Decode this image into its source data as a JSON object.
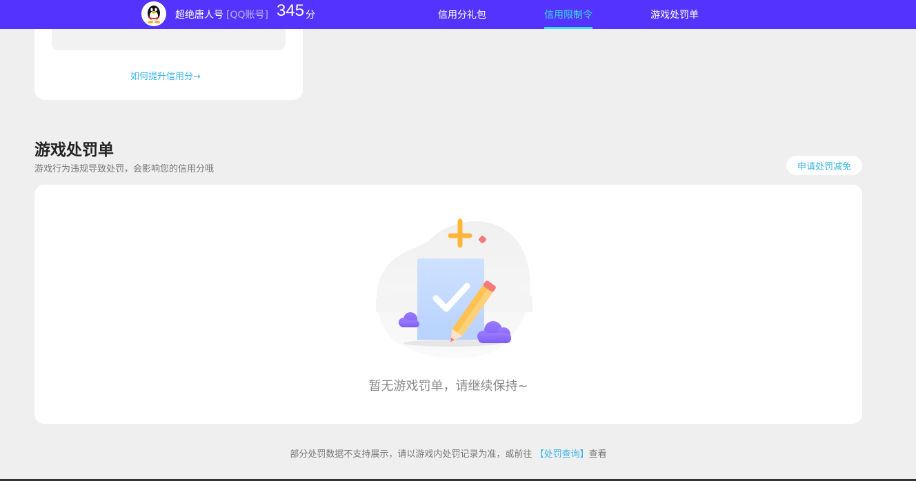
{
  "header": {
    "username": "超绝唐人号",
    "account_type": "[QQ账号]",
    "score": "345",
    "score_unit": "分",
    "nav": [
      {
        "label": "信用分礼包",
        "active": false
      },
      {
        "label": "信用限制令",
        "active": true
      },
      {
        "label": "游戏处罚单",
        "active": false
      }
    ],
    "accent_color": "#5533ff",
    "active_color": "#35e0ee"
  },
  "upper_card": {
    "link_text": "如何提升信用分→"
  },
  "penalty_section": {
    "title": "游戏处罚单",
    "subtitle": "游戏行为违规导致处罚，会影响您的信用分哦",
    "apply_button": "申请处罚减免",
    "empty_text": "暂无游戏罚单，请继续保持~"
  },
  "footer": {
    "note_before": "部分处罚数据不支持展示，请以游戏内处罚记录为准，或前往",
    "note_link": "【处罚查询】",
    "note_after": "查看"
  }
}
